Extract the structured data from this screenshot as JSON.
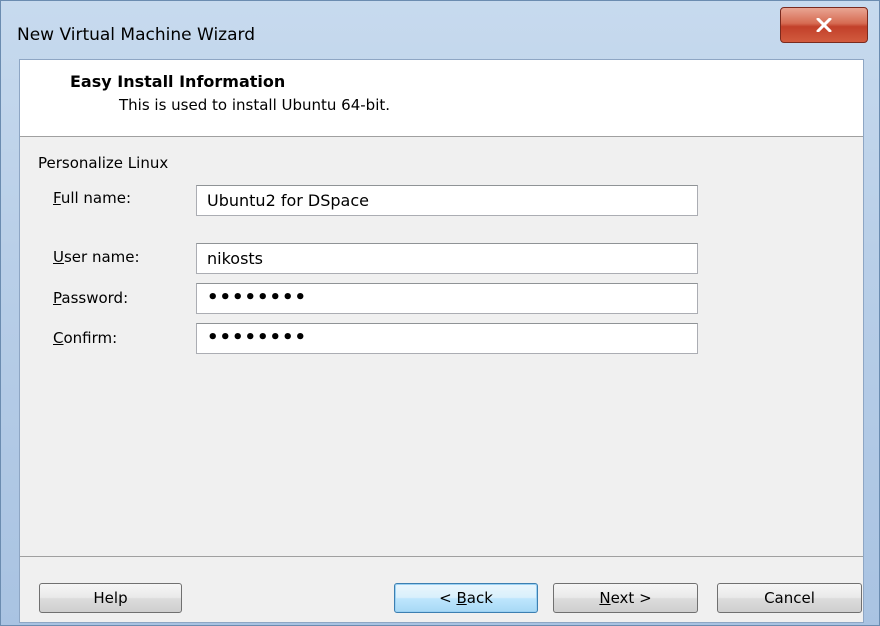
{
  "window": {
    "title": "New Virtual Machine Wizard",
    "close_icon": "close-x-icon"
  },
  "header": {
    "title": "Easy Install Information",
    "subtitle": "This is used to install Ubuntu 64-bit."
  },
  "group": {
    "label": "Personalize Linux"
  },
  "fields": {
    "full_name": {
      "mnemonic": "F",
      "label_rest": "ull name:",
      "value": "Ubuntu2 for DSpace"
    },
    "user_name": {
      "mnemonic": "U",
      "label_rest": "ser name:",
      "value": "nikosts"
    },
    "password": {
      "mnemonic": "P",
      "label_rest": "assword:",
      "value": "••••••••"
    },
    "confirm": {
      "mnemonic": "C",
      "label_rest": "onfirm:",
      "value": "••••••••"
    }
  },
  "buttons": {
    "help": "Help",
    "back_prefix": "< ",
    "back_mnemonic": "B",
    "back_rest": "ack",
    "next_mnemonic": "N",
    "next_rest": "ext >",
    "cancel": "Cancel"
  }
}
